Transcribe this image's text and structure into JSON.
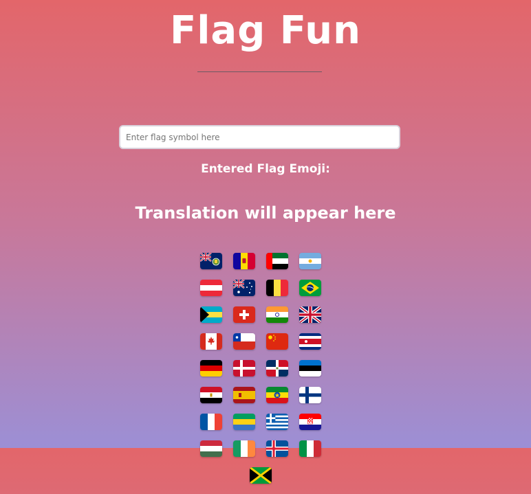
{
  "header": {
    "title": "Flag Fun"
  },
  "input": {
    "placeholder": "Enter flag symbol here",
    "value": ""
  },
  "output": {
    "entered_label": "Entered Flag Emoji:",
    "translation": "Translation will appear here"
  },
  "flags": [
    {
      "name": "south-georgia"
    },
    {
      "name": "andorra"
    },
    {
      "name": "uae"
    },
    {
      "name": "argentina"
    },
    {
      "name": "austria"
    },
    {
      "name": "australia"
    },
    {
      "name": "belgium"
    },
    {
      "name": "brazil"
    },
    {
      "name": "bahamas"
    },
    {
      "name": "switzerland"
    },
    {
      "name": "india"
    },
    {
      "name": "united-kingdom"
    },
    {
      "name": "canada"
    },
    {
      "name": "chile"
    },
    {
      "name": "china"
    },
    {
      "name": "costa-rica"
    },
    {
      "name": "germany"
    },
    {
      "name": "denmark"
    },
    {
      "name": "dominican-republic"
    },
    {
      "name": "estonia"
    },
    {
      "name": "egypt"
    },
    {
      "name": "spain"
    },
    {
      "name": "ethiopia"
    },
    {
      "name": "finland"
    },
    {
      "name": "france"
    },
    {
      "name": "gabon"
    },
    {
      "name": "greece"
    },
    {
      "name": "croatia"
    },
    {
      "name": "hungary"
    },
    {
      "name": "ireland"
    },
    {
      "name": "iceland"
    },
    {
      "name": "italy"
    },
    {
      "name": "jamaica"
    }
  ]
}
